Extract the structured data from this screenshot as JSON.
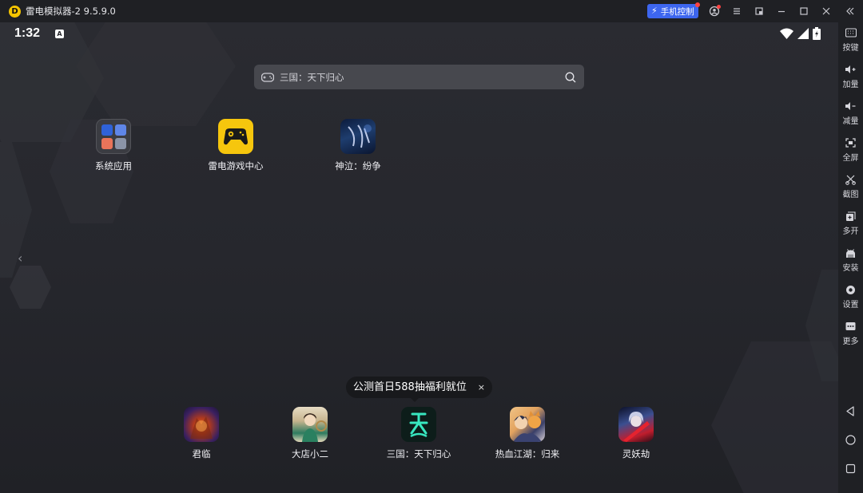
{
  "window": {
    "logo_letter": "D",
    "title": "雷电模拟器-2 9.5.9.0",
    "phone_control_label": "手机控制",
    "controls": [
      "user-icon",
      "menu-icon",
      "restore-window-icon",
      "minimize-icon",
      "maximize-icon",
      "close-icon",
      "collapse-sidebar-icon"
    ]
  },
  "statusbar": {
    "time": "1:32",
    "badge": "A"
  },
  "search": {
    "text": "三国：天下归心"
  },
  "desktop_apps": [
    {
      "label": "系统应用"
    },
    {
      "label": "雷电游戏中心"
    },
    {
      "label": "神泣：纷争"
    }
  ],
  "promo_bubble": {
    "text": "公测首日588抽福利就位",
    "close": "×"
  },
  "dock_apps": [
    {
      "label": "君临"
    },
    {
      "label": "大店小二"
    },
    {
      "label": "三国：天下归心"
    },
    {
      "label": "热血江湖：归来"
    },
    {
      "label": "灵妖劫"
    }
  ],
  "sidebar": {
    "items": [
      {
        "label": "按键",
        "icon": "keyboard-icon"
      },
      {
        "label": "加量",
        "icon": "volume-up-icon"
      },
      {
        "label": "减量",
        "icon": "volume-down-icon"
      },
      {
        "label": "全屏",
        "icon": "fullscreen-icon"
      },
      {
        "label": "截图",
        "icon": "scissors-icon"
      },
      {
        "label": "多开",
        "icon": "multi-instance-icon"
      },
      {
        "label": "安装",
        "icon": "install-icon"
      },
      {
        "label": "设置",
        "icon": "gear-icon"
      },
      {
        "label": "更多",
        "icon": "more-icon"
      }
    ],
    "nav": [
      "back-icon",
      "home-icon",
      "recents-icon"
    ]
  },
  "colors": {
    "accent": "#3d66ef",
    "leidian_yellow": "#f6c60d",
    "background": "#26272d"
  }
}
